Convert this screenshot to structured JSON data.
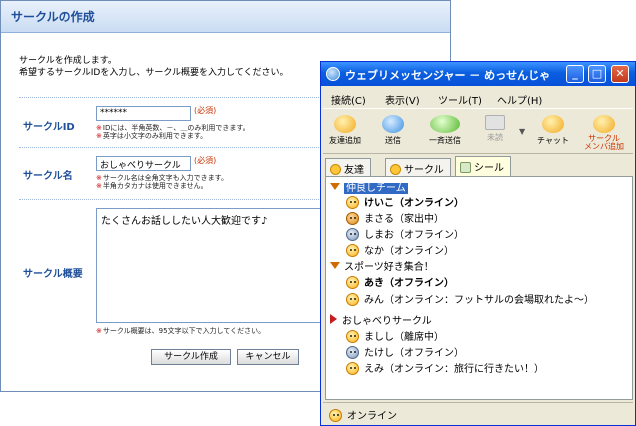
{
  "form": {
    "title": "サークルの作成",
    "intro_line1": "サークルを作成します。",
    "intro_line2": "希望するサークルIDを入力し、サークル概要を入力してください。",
    "id_label": "サークルID",
    "id_value": "******",
    "id_required": "(必須)",
    "id_note1": "IDには、半角英数、－、＿のみ利用できます。",
    "id_note2": "英字は小文字のみ利用できます。",
    "name_label": "サークル名",
    "name_value": "おしゃべりサークル",
    "name_required": "(必須)",
    "name_note1": "サークル名は全角文字も入力できます。",
    "name_note2": "半角カタカナは使用できません。",
    "desc_label": "サークル概要",
    "desc_value": "たくさんお話ししたい人大歓迎です♪",
    "desc_note": "サークル概要は、95文字以下で入力してください。",
    "note_mark": "※",
    "create_button": "サークル作成",
    "cancel_button": "キャンセル"
  },
  "messenger": {
    "title": "ウェブリメッセンジャー － めっせんじゃ",
    "window_buttons": {
      "minimize": "_",
      "maximize": "□",
      "close": "✕"
    },
    "menu": [
      "接続(C)",
      "表示(V)",
      "ツール(T)",
      "ヘルプ(H)"
    ],
    "toolbar": [
      {
        "label": "友達追加",
        "icon": "add-friend-icon",
        "color": "#f2a81e"
      },
      {
        "label": "送信",
        "icon": "send-icon",
        "color": "#3b8fe0"
      },
      {
        "label": "一斉送信",
        "icon": "broadcast-icon",
        "color": "#55b830"
      },
      {
        "label": "未読",
        "icon": "mail-icon",
        "color": "#c8c8c8"
      },
      {
        "label": "チャット",
        "icon": "chat-icon",
        "color": "#f2a81e"
      },
      {
        "label": "サークル\nメンバ追加",
        "icon": "add-member-icon",
        "color": "#f2a81e"
      }
    ],
    "tabs": [
      "友達",
      "サークル",
      "シール"
    ],
    "groups": [
      {
        "name": "仲良しチーム",
        "members": [
          {
            "text": "けいこ（オンライン）",
            "status": "online",
            "bold": true
          },
          {
            "text": "まさる（家出中）",
            "status": "away",
            "bold": false
          },
          {
            "text": "しまお（オフライン）",
            "status": "offline",
            "bold": false
          },
          {
            "text": "なか（オンライン）",
            "status": "online",
            "bold": false
          }
        ]
      },
      {
        "name": "スポーツ好き集合！",
        "members": [
          {
            "text": "あき（オフライン）",
            "status": "online",
            "bold": true
          },
          {
            "text": "みん（オンライン：フットサルの会場取れたよ～）",
            "status": "online",
            "bold": false
          }
        ]
      },
      {
        "name": "おしゃべりサークル",
        "members": [
          {
            "text": "ましし（離席中）",
            "status": "online",
            "bold": false
          },
          {
            "text": "たけし（オフライン）",
            "status": "offline",
            "bold": false
          },
          {
            "text": "えみ（オンライン：旅行に行きたい！）",
            "status": "online",
            "bold": false
          }
        ]
      }
    ],
    "status": "オンライン"
  }
}
